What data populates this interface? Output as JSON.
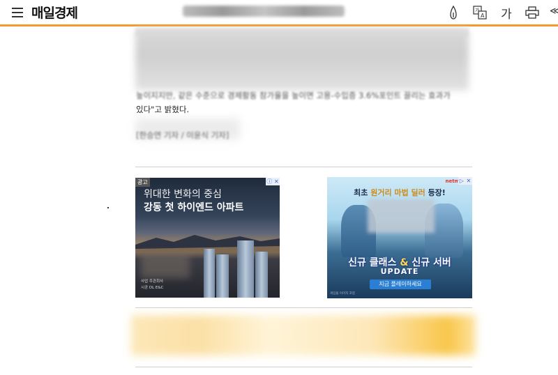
{
  "header": {
    "logo": "매일경제",
    "font_size_label": "가",
    "share_cut": "≪",
    "accent_color": "#f39a2b",
    "icons": [
      "menu-icon",
      "hand-icon",
      "translate-icon",
      "font-size-icon",
      "print-icon",
      "share-icon"
    ]
  },
  "article": {
    "line1": "높이지지만, 같은 수준으로 경제활동 참가율을 높이면 고용-수입증 3.6%포인트 끌리는 효과가",
    "line2": "있다\"고 밝혔다.",
    "byline": "[한승연 기자 / 이윤식 기자]"
  },
  "ads": {
    "tag": "광고",
    "ad1": {
      "headline1": "위대한 변화의 중심",
      "headline2": "강동 첫 하이엔드 아파트",
      "small1": "사업 주관회사",
      "small2": "시공 DL E&C"
    },
    "ad2": {
      "brand": "netm◎",
      "title_pre": "최초 ",
      "title_em": "원거리 마법 딜러",
      "title_post": " 등장!",
      "main_pre": "신규 클래스 ",
      "main_amp": "&",
      "main_post": " 신규 서버",
      "update": "UPDATE",
      "cta": "지금 플레이하세요",
      "small": "게임물 이미지 포함"
    }
  }
}
